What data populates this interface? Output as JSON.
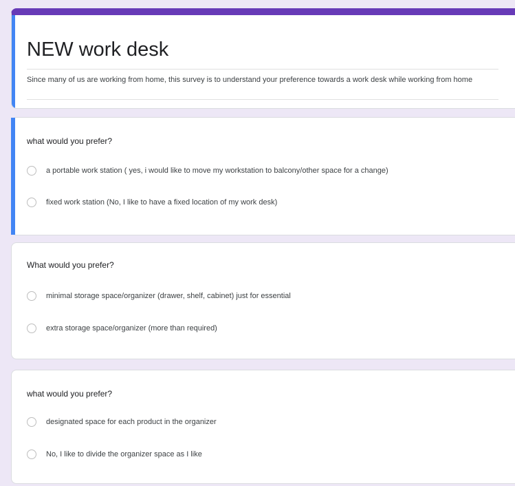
{
  "form": {
    "title": "NEW work desk",
    "description": "Since many of us are working from home, this survey is to understand your preference towards a work desk while working from home",
    "accent_color": "#673ab7",
    "active_color": "#4285f4",
    "background_color": "#ede7f6"
  },
  "questions": [
    {
      "text": "what would you prefer?",
      "options": [
        "a portable work station ( yes, i would like to move my workstation to balcony/other space for a change)",
        "fixed work station (No, I like to have a fixed location of my work desk)"
      ]
    },
    {
      "text": "What would you prefer?",
      "options": [
        "minimal storage space/organizer (drawer, shelf, cabinet) just for essential",
        "extra storage space/organizer (more than required)"
      ]
    },
    {
      "text": "what would you prefer?",
      "options": [
        "designated space for each product in the organizer",
        "No, I like to divide the organizer space as I like"
      ]
    }
  ]
}
